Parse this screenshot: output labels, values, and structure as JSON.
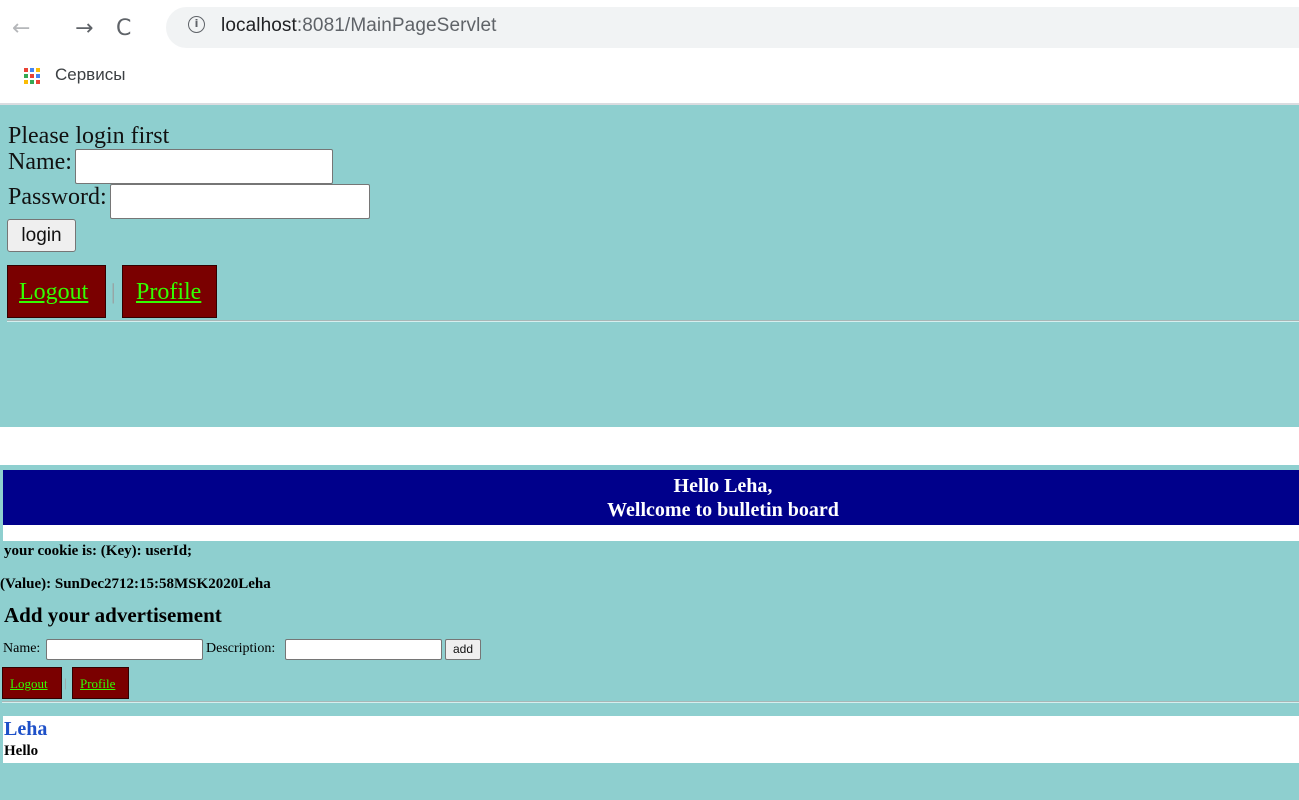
{
  "browser": {
    "url_host": "localhost",
    "url_rest": ":8081/MainPageServlet",
    "back_glyph": "←",
    "forward_glyph": "→",
    "reload_glyph": "C",
    "info_glyph": "i",
    "bookmark_label": "Сервисы"
  },
  "icons": {
    "back": "back-arrow-icon",
    "forward": "forward-arrow-icon",
    "reload": "reload-icon",
    "info": "info-icon",
    "apps": "apps-grid-icon"
  },
  "login": {
    "prompt": "Please login first",
    "name_label": "Name:",
    "name_value": "",
    "password_label": "Password:",
    "password_value": "",
    "login_button": "login",
    "logout_link": "Logout",
    "separator": "|",
    "profile_link": "Profile"
  },
  "bulletin": {
    "greeting_line1": "Hello Leha,",
    "greeting_line2": "Wellcome to bulletin board",
    "cookie_key_line": "your cookie is: (Key): userId;",
    "cookie_value_line": "(Value): SunDec2712:15:58MSK2020Leha",
    "add_heading": "Add your advertisement",
    "name_label": "Name:",
    "name_value": "",
    "description_label": "Description:",
    "description_value": "",
    "add_button": "add",
    "logout_link": "Logout",
    "separator": "|",
    "profile_link": "Profile",
    "ads": [
      {
        "user": "Leha",
        "text": "Hello"
      }
    ]
  },
  "colors": {
    "page_teal": "#8ecfcf",
    "banner_navy": "#00008b",
    "nav_box_maroon": "#7a0000",
    "link_green": "#33ff00",
    "ad_user_blue": "#1e50c8"
  }
}
